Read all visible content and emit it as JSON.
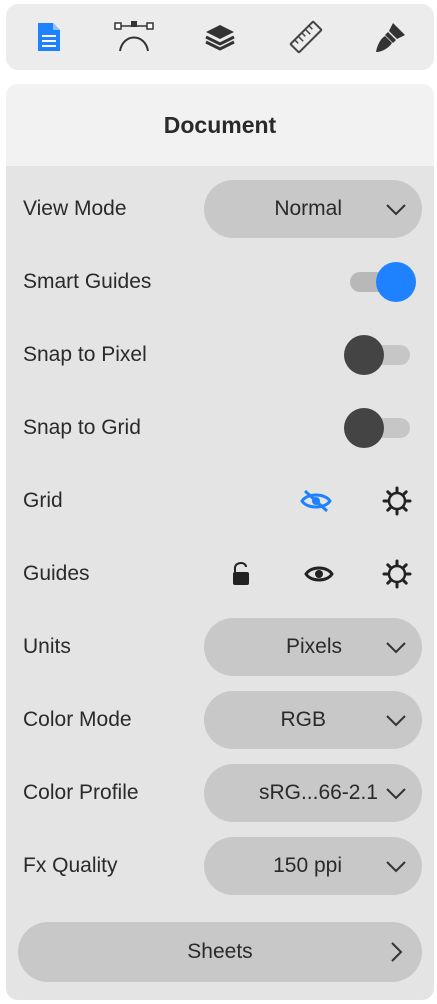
{
  "toolbar": {
    "tools": [
      {
        "icon": "document-icon",
        "active": true
      },
      {
        "icon": "bezier-pen-icon",
        "active": false
      },
      {
        "icon": "layers-icon",
        "active": false
      },
      {
        "icon": "ruler-icon",
        "active": false
      },
      {
        "icon": "brush-icon",
        "active": false
      }
    ]
  },
  "panel": {
    "title": "Document",
    "view_mode": {
      "label": "View Mode",
      "value": "Normal"
    },
    "smart_guides": {
      "label": "Smart Guides",
      "on": true
    },
    "snap_to_pixel": {
      "label": "Snap to Pixel",
      "on": false
    },
    "snap_to_grid": {
      "label": "Snap to Grid",
      "on": false
    },
    "grid": {
      "label": "Grid",
      "icons": [
        "eye-hidden-icon",
        "gear-icon"
      ]
    },
    "guides": {
      "label": "Guides",
      "icons": [
        "lock-icon",
        "eye-icon",
        "gear-icon"
      ]
    },
    "units": {
      "label": "Units",
      "value": "Pixels"
    },
    "color_mode": {
      "label": "Color Mode",
      "value": "RGB"
    },
    "color_profile": {
      "label": "Color Profile",
      "value": "sRG...66-2.1"
    },
    "fx_quality": {
      "label": "Fx Quality",
      "value": "150 ppi"
    },
    "sheets": {
      "label": "Sheets"
    }
  },
  "colors": {
    "accent": "#1e82ff",
    "panel_bg": "#e4e4e4",
    "control_bg": "#c8c8c8"
  }
}
